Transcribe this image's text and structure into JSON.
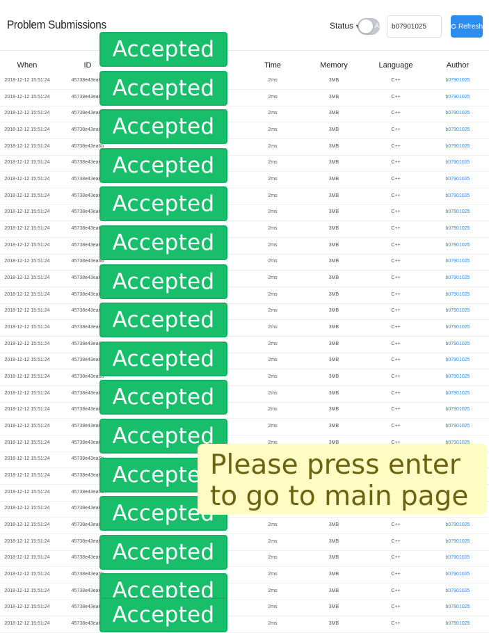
{
  "header": {
    "title": "Problem Submissions",
    "status_label": "Status",
    "status_caret": "▼",
    "toggle_text": "All",
    "search_value": "b07901025",
    "refresh_label": "Refresh",
    "refresh_icon": "refresh-icon"
  },
  "table": {
    "columns": [
      "When",
      "ID",
      "Time",
      "Memory",
      "Language",
      "Author"
    ],
    "row_template": {
      "when": "2018-12-12 15:51:24",
      "id": "45738e43ea6b",
      "time": "2ms",
      "memory": "3MB",
      "language": "C++",
      "author": "b07901025"
    },
    "row_count": 34
  },
  "badge_label": "Accepted",
  "badge_count": 16,
  "toast": {
    "line1": "Please press enter",
    "line2": "to go to main page"
  },
  "colors": {
    "accepted": "#19be6b",
    "primary": "#2d8cf0",
    "toast_bg": "#fffcc3"
  }
}
